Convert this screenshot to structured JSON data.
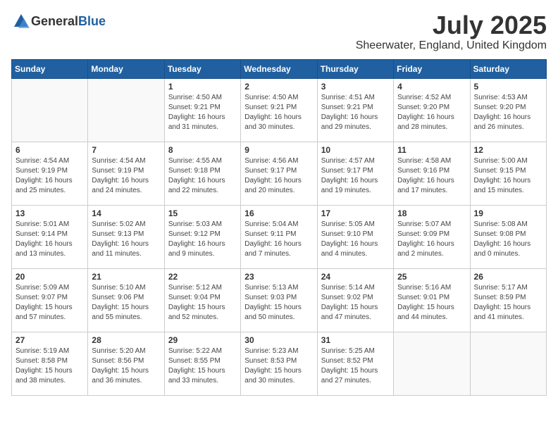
{
  "header": {
    "logo_general": "General",
    "logo_blue": "Blue",
    "month": "July 2025",
    "location": "Sheerwater, England, United Kingdom"
  },
  "days_of_week": [
    "Sunday",
    "Monday",
    "Tuesday",
    "Wednesday",
    "Thursday",
    "Friday",
    "Saturday"
  ],
  "weeks": [
    [
      {
        "day": "",
        "sunrise": "",
        "sunset": "",
        "daylight": ""
      },
      {
        "day": "",
        "sunrise": "",
        "sunset": "",
        "daylight": ""
      },
      {
        "day": "1",
        "sunrise": "Sunrise: 4:50 AM",
        "sunset": "Sunset: 9:21 PM",
        "daylight": "Daylight: 16 hours and 31 minutes."
      },
      {
        "day": "2",
        "sunrise": "Sunrise: 4:50 AM",
        "sunset": "Sunset: 9:21 PM",
        "daylight": "Daylight: 16 hours and 30 minutes."
      },
      {
        "day": "3",
        "sunrise": "Sunrise: 4:51 AM",
        "sunset": "Sunset: 9:21 PM",
        "daylight": "Daylight: 16 hours and 29 minutes."
      },
      {
        "day": "4",
        "sunrise": "Sunrise: 4:52 AM",
        "sunset": "Sunset: 9:20 PM",
        "daylight": "Daylight: 16 hours and 28 minutes."
      },
      {
        "day": "5",
        "sunrise": "Sunrise: 4:53 AM",
        "sunset": "Sunset: 9:20 PM",
        "daylight": "Daylight: 16 hours and 26 minutes."
      }
    ],
    [
      {
        "day": "6",
        "sunrise": "Sunrise: 4:54 AM",
        "sunset": "Sunset: 9:19 PM",
        "daylight": "Daylight: 16 hours and 25 minutes."
      },
      {
        "day": "7",
        "sunrise": "Sunrise: 4:54 AM",
        "sunset": "Sunset: 9:19 PM",
        "daylight": "Daylight: 16 hours and 24 minutes."
      },
      {
        "day": "8",
        "sunrise": "Sunrise: 4:55 AM",
        "sunset": "Sunset: 9:18 PM",
        "daylight": "Daylight: 16 hours and 22 minutes."
      },
      {
        "day": "9",
        "sunrise": "Sunrise: 4:56 AM",
        "sunset": "Sunset: 9:17 PM",
        "daylight": "Daylight: 16 hours and 20 minutes."
      },
      {
        "day": "10",
        "sunrise": "Sunrise: 4:57 AM",
        "sunset": "Sunset: 9:17 PM",
        "daylight": "Daylight: 16 hours and 19 minutes."
      },
      {
        "day": "11",
        "sunrise": "Sunrise: 4:58 AM",
        "sunset": "Sunset: 9:16 PM",
        "daylight": "Daylight: 16 hours and 17 minutes."
      },
      {
        "day": "12",
        "sunrise": "Sunrise: 5:00 AM",
        "sunset": "Sunset: 9:15 PM",
        "daylight": "Daylight: 16 hours and 15 minutes."
      }
    ],
    [
      {
        "day": "13",
        "sunrise": "Sunrise: 5:01 AM",
        "sunset": "Sunset: 9:14 PM",
        "daylight": "Daylight: 16 hours and 13 minutes."
      },
      {
        "day": "14",
        "sunrise": "Sunrise: 5:02 AM",
        "sunset": "Sunset: 9:13 PM",
        "daylight": "Daylight: 16 hours and 11 minutes."
      },
      {
        "day": "15",
        "sunrise": "Sunrise: 5:03 AM",
        "sunset": "Sunset: 9:12 PM",
        "daylight": "Daylight: 16 hours and 9 minutes."
      },
      {
        "day": "16",
        "sunrise": "Sunrise: 5:04 AM",
        "sunset": "Sunset: 9:11 PM",
        "daylight": "Daylight: 16 hours and 7 minutes."
      },
      {
        "day": "17",
        "sunrise": "Sunrise: 5:05 AM",
        "sunset": "Sunset: 9:10 PM",
        "daylight": "Daylight: 16 hours and 4 minutes."
      },
      {
        "day": "18",
        "sunrise": "Sunrise: 5:07 AM",
        "sunset": "Sunset: 9:09 PM",
        "daylight": "Daylight: 16 hours and 2 minutes."
      },
      {
        "day": "19",
        "sunrise": "Sunrise: 5:08 AM",
        "sunset": "Sunset: 9:08 PM",
        "daylight": "Daylight: 16 hours and 0 minutes."
      }
    ],
    [
      {
        "day": "20",
        "sunrise": "Sunrise: 5:09 AM",
        "sunset": "Sunset: 9:07 PM",
        "daylight": "Daylight: 15 hours and 57 minutes."
      },
      {
        "day": "21",
        "sunrise": "Sunrise: 5:10 AM",
        "sunset": "Sunset: 9:06 PM",
        "daylight": "Daylight: 15 hours and 55 minutes."
      },
      {
        "day": "22",
        "sunrise": "Sunrise: 5:12 AM",
        "sunset": "Sunset: 9:04 PM",
        "daylight": "Daylight: 15 hours and 52 minutes."
      },
      {
        "day": "23",
        "sunrise": "Sunrise: 5:13 AM",
        "sunset": "Sunset: 9:03 PM",
        "daylight": "Daylight: 15 hours and 50 minutes."
      },
      {
        "day": "24",
        "sunrise": "Sunrise: 5:14 AM",
        "sunset": "Sunset: 9:02 PM",
        "daylight": "Daylight: 15 hours and 47 minutes."
      },
      {
        "day": "25",
        "sunrise": "Sunrise: 5:16 AM",
        "sunset": "Sunset: 9:01 PM",
        "daylight": "Daylight: 15 hours and 44 minutes."
      },
      {
        "day": "26",
        "sunrise": "Sunrise: 5:17 AM",
        "sunset": "Sunset: 8:59 PM",
        "daylight": "Daylight: 15 hours and 41 minutes."
      }
    ],
    [
      {
        "day": "27",
        "sunrise": "Sunrise: 5:19 AM",
        "sunset": "Sunset: 8:58 PM",
        "daylight": "Daylight: 15 hours and 38 minutes."
      },
      {
        "day": "28",
        "sunrise": "Sunrise: 5:20 AM",
        "sunset": "Sunset: 8:56 PM",
        "daylight": "Daylight: 15 hours and 36 minutes."
      },
      {
        "day": "29",
        "sunrise": "Sunrise: 5:22 AM",
        "sunset": "Sunset: 8:55 PM",
        "daylight": "Daylight: 15 hours and 33 minutes."
      },
      {
        "day": "30",
        "sunrise": "Sunrise: 5:23 AM",
        "sunset": "Sunset: 8:53 PM",
        "daylight": "Daylight: 15 hours and 30 minutes."
      },
      {
        "day": "31",
        "sunrise": "Sunrise: 5:25 AM",
        "sunset": "Sunset: 8:52 PM",
        "daylight": "Daylight: 15 hours and 27 minutes."
      },
      {
        "day": "",
        "sunrise": "",
        "sunset": "",
        "daylight": ""
      },
      {
        "day": "",
        "sunrise": "",
        "sunset": "",
        "daylight": ""
      }
    ]
  ]
}
